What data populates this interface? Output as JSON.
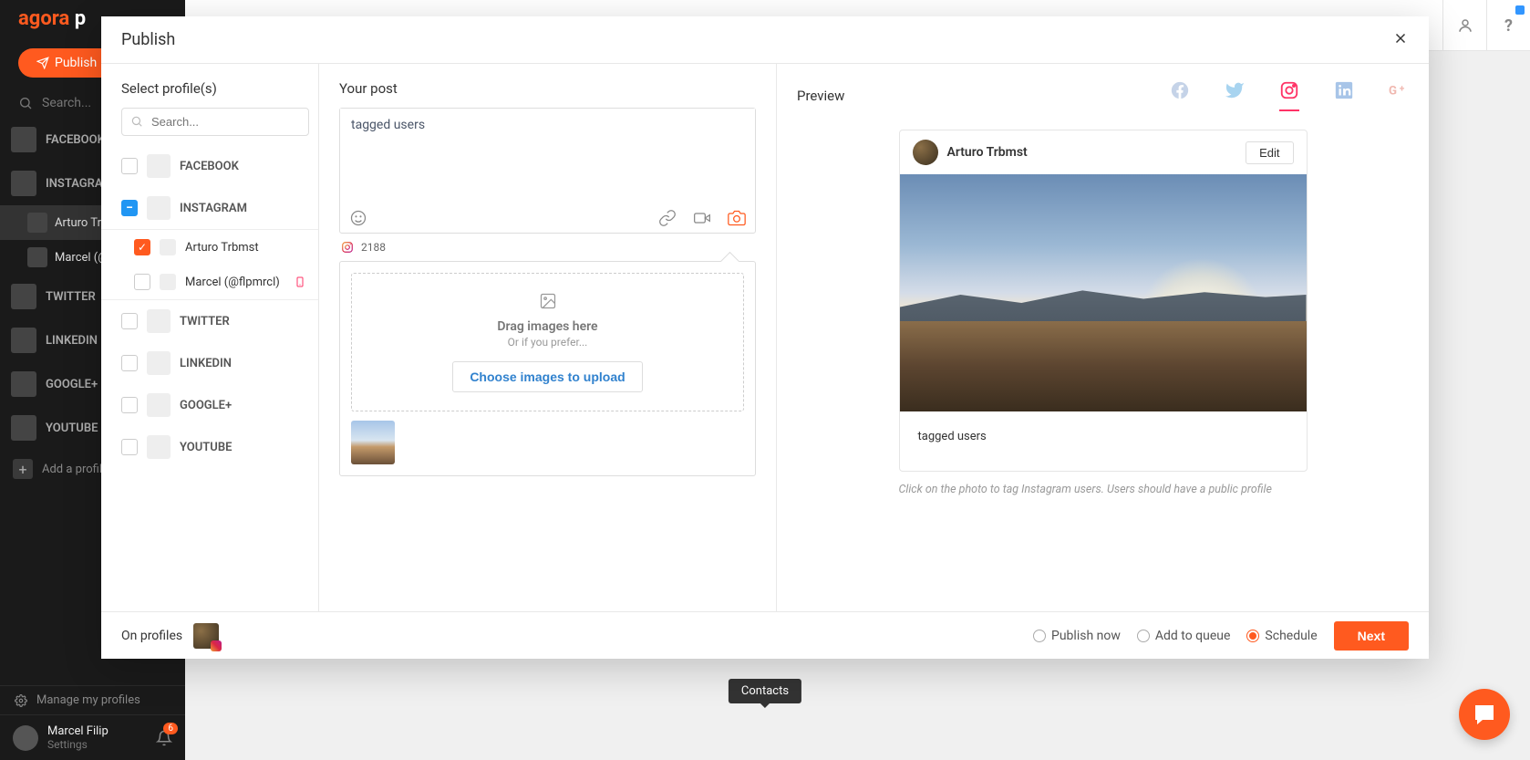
{
  "app": {
    "logo_a": "agora",
    "logo_b": " p",
    "publish": "Publish",
    "search_placeholder": "Search..."
  },
  "sidebar_networks": [
    {
      "label": "FACEBOOK"
    },
    {
      "label": "INSTAGRAM",
      "children": [
        {
          "label": "Arturo Trbmst",
          "active": true
        },
        {
          "label": "Marcel (@flpmrcl)"
        }
      ]
    },
    {
      "label": "TWITTER"
    },
    {
      "label": "LINKEDIN"
    },
    {
      "label": "GOOGLE+"
    },
    {
      "label": "YOUTUBE"
    }
  ],
  "add_profile": "Add a profile",
  "manage": "Manage my profiles",
  "user": {
    "name": "Marcel Filip",
    "settings": "Settings",
    "notifications": "6"
  },
  "modal": {
    "title": "Publish",
    "profiles_title": "Select profile(s)",
    "profile_search_placeholder": "Search...",
    "profile_groups": [
      {
        "label": "FACEBOOK",
        "state": "unchecked"
      },
      {
        "label": "INSTAGRAM",
        "state": "partial",
        "children": [
          {
            "label": "Arturo Trbmst",
            "state": "checked"
          },
          {
            "label": "Marcel (@flpmrcl)",
            "state": "unchecked",
            "mobile": true
          }
        ]
      },
      {
        "label": "TWITTER",
        "state": "unchecked"
      },
      {
        "label": "LINKEDIN",
        "state": "unchecked"
      },
      {
        "label": "GOOGLE+",
        "state": "unchecked"
      },
      {
        "label": "YOUTUBE",
        "state": "unchecked"
      }
    ],
    "post_title": "Your post",
    "post_text": "tagged users",
    "char_count": "2188",
    "dropzone": {
      "title": "Drag images here",
      "sub": "Or if you prefer...",
      "button": "Choose images to upload"
    },
    "preview": {
      "title": "Preview",
      "tabs": [
        "facebook",
        "twitter",
        "instagram",
        "linkedin",
        "googleplus"
      ],
      "active_tab": "instagram",
      "user": "Arturo Trbmst",
      "edit": "Edit",
      "caption": "tagged users",
      "hint": "Click on the photo to tag Instagram users. Users should have a public profile"
    },
    "footer": {
      "on_profiles": "On profiles",
      "options": [
        {
          "label": "Publish now",
          "checked": false
        },
        {
          "label": "Add to queue",
          "checked": false
        },
        {
          "label": "Schedule",
          "checked": true
        }
      ],
      "next": "Next"
    }
  },
  "contacts_tooltip": "Contacts"
}
